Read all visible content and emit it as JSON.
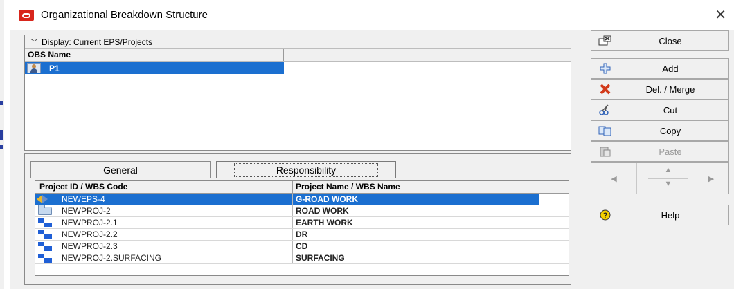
{
  "window": {
    "title": "Organizational Breakdown Structure",
    "close_glyph": "✕"
  },
  "obs_pane": {
    "display_label": "Display: Current EPS/Projects",
    "column_header": "OBS Name",
    "rows": [
      {
        "name": "P1",
        "icon": "obs-person-icon",
        "selected": true
      }
    ]
  },
  "tabs": {
    "general": "General",
    "responsibility": "Responsibility",
    "active": "responsibility"
  },
  "responsibility_grid": {
    "columns": [
      "Project ID / WBS Code",
      "Project Name / WBS Name"
    ],
    "rows": [
      {
        "code": "NEWEPS-4",
        "name": "G-ROAD WORK",
        "icon": "eps-icon",
        "selected": true
      },
      {
        "code": "NEWPROJ-2",
        "name": "ROAD WORK",
        "icon": "project-folder-icon",
        "selected": false
      },
      {
        "code": "NEWPROJ-2.1",
        "name": "EARTH WORK",
        "icon": "wbs-icon",
        "selected": false
      },
      {
        "code": "NEWPROJ-2.2",
        "name": "DR",
        "icon": "wbs-icon",
        "selected": false
      },
      {
        "code": "NEWPROJ-2.3",
        "name": "CD",
        "icon": "wbs-icon",
        "selected": false
      },
      {
        "code": "NEWPROJ-2.SURFACING",
        "name": "SURFACING",
        "icon": "wbs-icon",
        "selected": false
      }
    ]
  },
  "buttons": {
    "close": "Close",
    "add": "Add",
    "delete_merge": "Del. / Merge",
    "cut": "Cut",
    "copy": "Copy",
    "paste": "Paste",
    "help": "Help"
  },
  "colors": {
    "selection": "#1b6fd0",
    "brand": "#d8261c",
    "delete_icon": "#d23a1a"
  }
}
